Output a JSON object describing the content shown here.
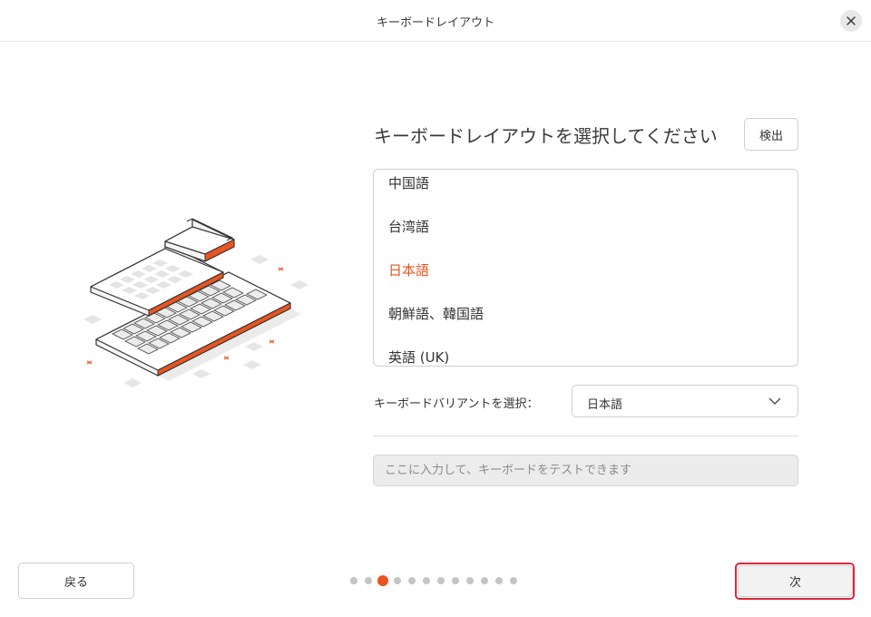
{
  "window": {
    "title": "キーボードレイアウト"
  },
  "main": {
    "heading": "キーボードレイアウトを選択してください",
    "detect_label": "検出",
    "layouts": [
      "中国語",
      "台湾語",
      "日本語",
      "朝鮮語、韓国語",
      "英語 (UK)"
    ],
    "selected_layout": "日本語",
    "variant_label": "キーボードバリアントを選択：",
    "variant_value": "日本語",
    "test_placeholder": "ここに入力して、キーボードをテストできます"
  },
  "footer": {
    "back_label": "戻る",
    "next_label": "次",
    "total_steps": 12,
    "current_step": 3
  },
  "colors": {
    "accent": "#e95420",
    "focus_outline": "#e0263a"
  },
  "icons": {
    "close": "close-icon",
    "chevron": "chevron-down-icon",
    "illustration": "keyboard-illustration"
  }
}
